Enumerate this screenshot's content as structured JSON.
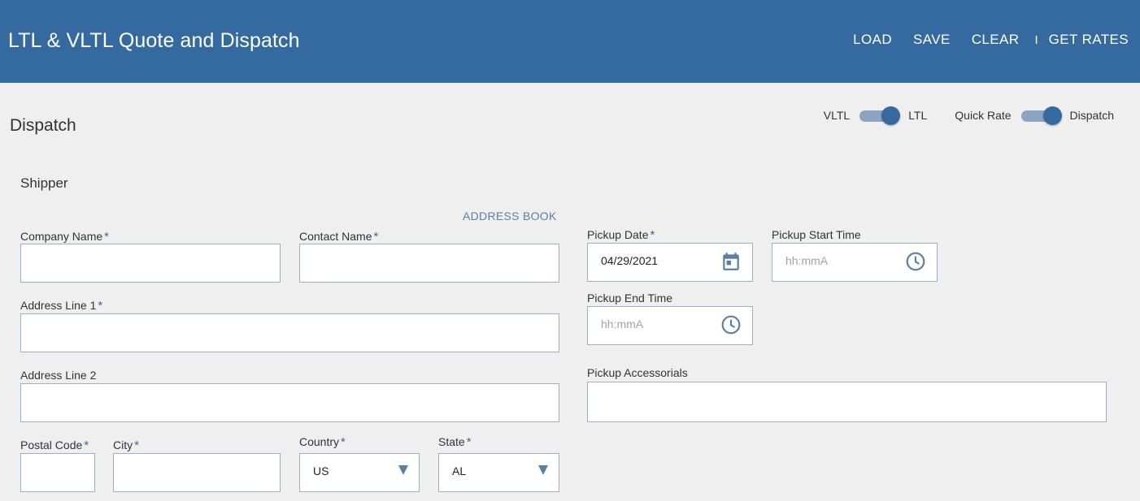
{
  "header": {
    "title": "LTL & VLTL Quote and Dispatch",
    "actions": {
      "load": "LOAD",
      "save": "SAVE",
      "clear": "CLEAR",
      "separator": "I",
      "get_rates": "GET RATES"
    },
    "background": "#346a9f"
  },
  "page": {
    "section_title": "Dispatch",
    "sub_title": "Shipper"
  },
  "toggles": {
    "mode": {
      "left_label": "VLTL",
      "right_label": "LTL",
      "selected": "LTL"
    },
    "type": {
      "left_label": "Quick Rate",
      "right_label": "Dispatch",
      "selected": "Dispatch"
    }
  },
  "links": {
    "address_book": "ADDRESS BOOK"
  },
  "shipper": {
    "company_name": {
      "label": "Company Name",
      "required": "*",
      "value": ""
    },
    "contact_name": {
      "label": "Contact Name",
      "required": "*",
      "value": ""
    },
    "address_line_1": {
      "label": "Address Line 1",
      "required": "*",
      "value": ""
    },
    "address_line_2": {
      "label": "Address Line 2",
      "value": ""
    },
    "postal_code": {
      "label": "Postal Code",
      "required": "*",
      "value": ""
    },
    "city": {
      "label": "City",
      "required": "*",
      "value": ""
    },
    "country": {
      "label": "Country",
      "required": "*",
      "value": "US",
      "icon": "chevron-down-icon"
    },
    "state": {
      "label": "State",
      "required": "*",
      "value": "AL",
      "icon": "chevron-down-icon"
    }
  },
  "pickup": {
    "date": {
      "label": "Pickup Date",
      "required": "*",
      "value": "04/29/2021",
      "icon": "calendar-icon"
    },
    "start_time": {
      "label": "Pickup Start Time",
      "placeholder": "hh:mmA",
      "icon": "clock-icon"
    },
    "end_time": {
      "label": "Pickup End Time",
      "placeholder": "hh:mmA",
      "icon": "clock-icon"
    },
    "accessorials": {
      "label": "Pickup Accessorials",
      "value": ""
    }
  },
  "colors": {
    "accent": "#346a9f",
    "toggle_track": "#8ca4bf",
    "field_border": "#9bb0c7",
    "background": "#efefef"
  }
}
